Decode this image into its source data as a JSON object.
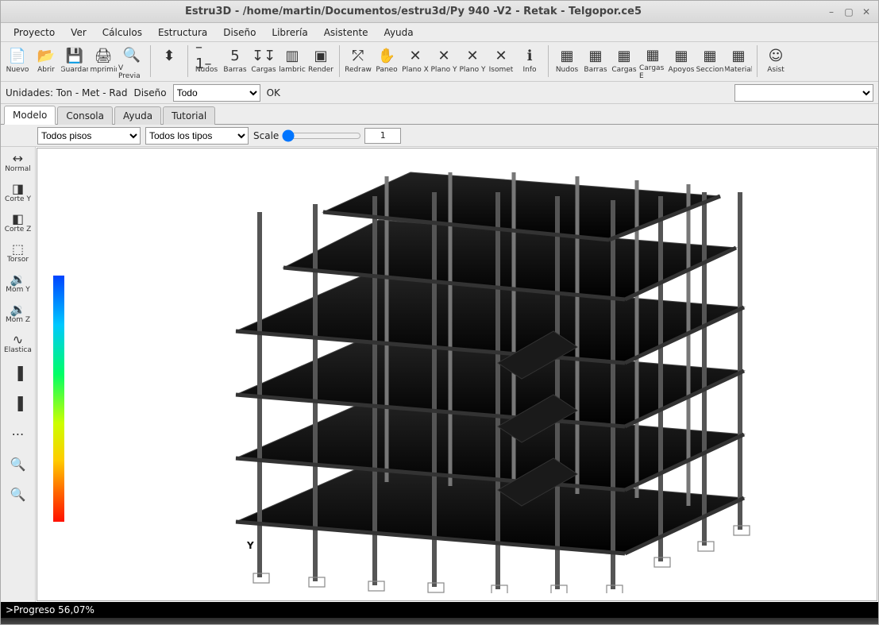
{
  "window": {
    "title": "Estru3D - /home/martin/Documentos/estru3d/Py 940 -V2 - Retak - Telgopor.ce5"
  },
  "menu": {
    "items": [
      "Proyecto",
      "Ver",
      "Cálculos",
      "Estructura",
      "Diseño",
      "Librería",
      "Asistente",
      "Ayuda"
    ]
  },
  "toolbar": {
    "buttons": [
      {
        "name": "nuevo",
        "label": "Nuevo",
        "glyph": "📄"
      },
      {
        "name": "abrir",
        "label": "Abrir",
        "glyph": "📂"
      },
      {
        "name": "guardar",
        "label": "Guardar",
        "glyph": "💾"
      },
      {
        "name": "imprimir",
        "label": "Imprimir",
        "glyph": "🖨"
      },
      {
        "name": "vprevia",
        "label": "V Previa",
        "glyph": "🔍"
      },
      {
        "sep": true
      },
      {
        "name": "t-1",
        "label": "",
        "glyph": "⬍"
      },
      {
        "sep": true
      },
      {
        "name": "nudos",
        "label": "Nudos",
        "glyph": "–1–"
      },
      {
        "name": "barras",
        "label": "Barras",
        "glyph": "5"
      },
      {
        "name": "cargas",
        "label": "Cargas",
        "glyph": "↧↧"
      },
      {
        "name": "alambrico",
        "label": "lambric",
        "glyph": "▥"
      },
      {
        "name": "render",
        "label": "Render",
        "glyph": "▣"
      },
      {
        "sep": true
      },
      {
        "name": "redraw",
        "label": "Redraw",
        "glyph": "⤱"
      },
      {
        "name": "paneo",
        "label": "Paneo",
        "glyph": "✋"
      },
      {
        "name": "planox",
        "label": "Plano X",
        "glyph": "✕"
      },
      {
        "name": "planoy",
        "label": "Plano Y",
        "glyph": "✕"
      },
      {
        "name": "planoy2",
        "label": "Plano Y",
        "glyph": "✕"
      },
      {
        "name": "isomet",
        "label": "Isomet",
        "glyph": "✕"
      },
      {
        "name": "info",
        "label": "Info",
        "glyph": "ℹ"
      },
      {
        "sep": true
      },
      {
        "name": "nudos2",
        "label": "Nudos",
        "glyph": "▦"
      },
      {
        "name": "barras2",
        "label": "Barras",
        "glyph": "▦"
      },
      {
        "name": "cargas2",
        "label": "Cargas",
        "glyph": "▦"
      },
      {
        "name": "cargase",
        "label": "Cargas E",
        "glyph": "▦"
      },
      {
        "name": "apoyos",
        "label": "Apoyos",
        "glyph": "▦"
      },
      {
        "name": "seccion",
        "label": "Seccion",
        "glyph": "▦"
      },
      {
        "name": "material",
        "label": "Material",
        "glyph": "▦"
      },
      {
        "sep": true
      },
      {
        "name": "asist",
        "label": "Asist",
        "glyph": "☺"
      }
    ]
  },
  "optbar": {
    "unidades_label": "Unidades: Ton - Met - Rad",
    "diseno_label": "Diseño",
    "diseno_value": "Todo",
    "ok_label": "OK"
  },
  "tabs": {
    "items": [
      "Modelo",
      "Consola",
      "Ayuda",
      "Tutorial"
    ],
    "active": 0
  },
  "subbar": {
    "pisos_value": "Todos pisos",
    "tipos_value": "Todos los tipos",
    "scale_label": "Scale",
    "scale_value": "1"
  },
  "leftbar": {
    "buttons": [
      {
        "name": "normal",
        "label": "Normal",
        "glyph": "↔"
      },
      {
        "name": "cortey",
        "label": "Corte Y",
        "glyph": "◨"
      },
      {
        "name": "cortez",
        "label": "Corte Z",
        "glyph": "◧"
      },
      {
        "name": "torsor",
        "label": "Torsor",
        "glyph": "⬚"
      },
      {
        "name": "momy",
        "label": "Mom Y",
        "glyph": "🔉"
      },
      {
        "name": "momz",
        "label": "Mom Z",
        "glyph": "🔉"
      },
      {
        "name": "elastica",
        "label": "Elastica",
        "glyph": "∿"
      },
      {
        "name": "tool-a",
        "label": "",
        "glyph": "▐"
      },
      {
        "name": "tool-b",
        "label": "",
        "glyph": "▐"
      },
      {
        "name": "tool-c",
        "label": "",
        "glyph": "⋯"
      },
      {
        "name": "zoom-in",
        "label": "",
        "glyph": "🔍"
      },
      {
        "name": "zoom-out",
        "label": "",
        "glyph": "🔍"
      }
    ]
  },
  "viewport": {
    "axis_y": "Y"
  },
  "status": {
    "text": ">Progreso 56,07%"
  }
}
